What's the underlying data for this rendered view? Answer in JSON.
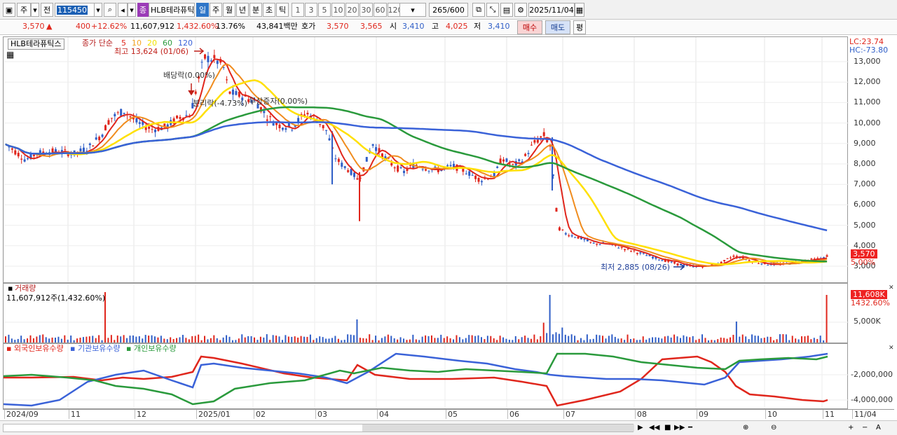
{
  "toolbar": {
    "period_char": "주",
    "prev_label": "전",
    "code": "115450",
    "stock_badge": "종",
    "stock_name": "HLB테라퓨틱",
    "periods": [
      "일",
      "주",
      "월",
      "년",
      "분",
      "초",
      "틱"
    ],
    "active_period": "일",
    "intervals": [
      "1",
      "3",
      "5",
      "10",
      "20",
      "30",
      "60",
      "120"
    ],
    "count": "265",
    "count_total": "/600",
    "date": "2025/11/04"
  },
  "quote": {
    "price": "3,570",
    "change": "400",
    "change_pct": "+12.62%",
    "volume": "11,607,912",
    "volume_pct": "1,432.60%",
    "turnover": "13.76%",
    "amount": "43,841백만",
    "ask_label": "호가",
    "ask": "3,570",
    "bid": "3,565",
    "open_label": "시",
    "open": "3,410",
    "high_label": "고",
    "high": "4,025",
    "low_label": "저",
    "low": "3,410",
    "buy_label": "매수",
    "sell_label": "매도",
    "eval_label": "평"
  },
  "price_panel": {
    "title": "HLB테라퓨틱스",
    "ma_label": "종가 단순",
    "ma": [
      {
        "label": "5",
        "color": "#e0261c"
      },
      {
        "label": "10",
        "color": "#f5a623"
      },
      {
        "label": "20",
        "color": "#f2e200"
      },
      {
        "label": "60",
        "color": "#2a9a3c"
      },
      {
        "label": "120",
        "color": "#3a62d8"
      }
    ],
    "lc": "LC:23.74",
    "hc": "HC:-73.80",
    "high_annot": "최고 13,624 (01/06)",
    "low_annot": "최저 2,885 (08/26)",
    "div_annot": "배당락(0.00%)",
    "split_annot": "분리락(-4.73%)",
    "rights_annot": "무상증자(0.00%)",
    "y_ticks": [
      "13,000",
      "12,000",
      "11,000",
      "10,000",
      "9,000",
      "8,000",
      "7,000",
      "6,000",
      "5,000",
      "4,000",
      "3,000"
    ],
    "last_price": "3,570",
    "last_pct": "5.00%"
  },
  "volume_panel": {
    "title": "거래량",
    "value": "11,607,912주(1,432.60%)",
    "badge": "11,608K",
    "badge_pct": "1432.60%",
    "y_ticks": [
      "5,000K"
    ]
  },
  "holdings_panel": {
    "series": [
      {
        "label": "외국인보유수량",
        "color": "#e0261c"
      },
      {
        "label": "기관보유수량",
        "color": "#3a62d8"
      },
      {
        "label": "개인보유수량",
        "color": "#2a9a3c"
      }
    ],
    "y_ticks": [
      "-2,000,000",
      "-4,000,000"
    ]
  },
  "x_axis": [
    "2024/09",
    "11",
    "12",
    "2025/01",
    "02",
    "03",
    "04",
    "05",
    "06",
    "07",
    "08",
    "09",
    "10",
    "11",
    "11/04"
  ],
  "colors": {
    "up": "#e0261c",
    "down": "#2f5ec7"
  }
}
